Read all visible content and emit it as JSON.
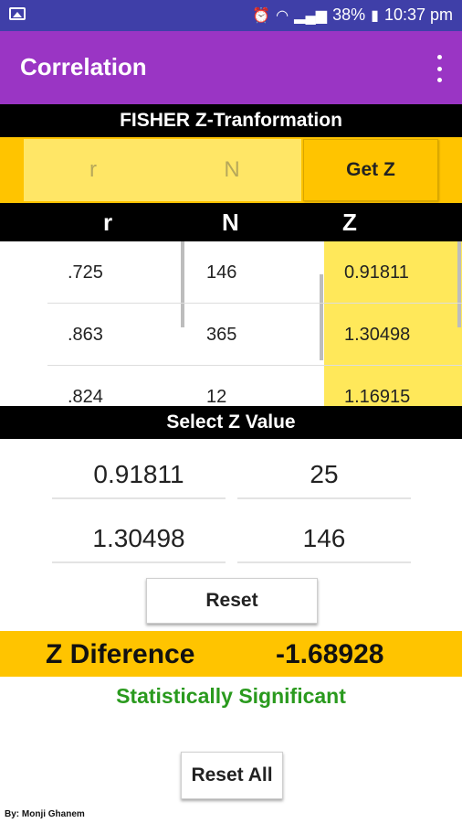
{
  "status_bar": {
    "battery": "38%",
    "time": "10:37 pm"
  },
  "app_bar": {
    "title": "Correlation"
  },
  "fisher_header": "FISHER Z-Tranformation",
  "inputs": {
    "r_placeholder": "r",
    "n_placeholder": "N",
    "get_z_label": "Get Z"
  },
  "table": {
    "headers": [
      "r",
      "N",
      "Z"
    ],
    "rows": [
      {
        "r": ".725",
        "n": "146",
        "z": "0.91811"
      },
      {
        "r": ".863",
        "n": "365",
        "z": "1.30498"
      },
      {
        "r": ".824",
        "n": "12",
        "z": "1.16915"
      }
    ]
  },
  "select_header": "Select Z Value",
  "selected": [
    {
      "z": "0.91811",
      "n": "25"
    },
    {
      "z": "1.30498",
      "n": "146"
    }
  ],
  "reset_label": "Reset",
  "z_difference": {
    "label": "Z Diference",
    "value": "-1.68928"
  },
  "significance": "Statistically Significant",
  "reset_all_label": "Reset All",
  "credit": "By: Monji Ghanem",
  "colors": {
    "status_bar": "#3f3fa8",
    "app_bar": "#9a35c4",
    "accent_yellow": "#ffc400",
    "light_yellow": "#ffe85a",
    "significant_green": "#2a9a1e"
  }
}
